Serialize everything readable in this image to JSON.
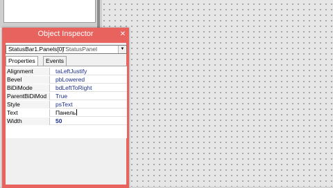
{
  "window": {
    "title": "Object Inspector",
    "close_glyph": "✕"
  },
  "component_selector": {
    "name": "StatusBar1.Panels[0]",
    "type": "TStatusPanel",
    "arrow_glyph": "▼"
  },
  "tabs": [
    {
      "label": "Properties",
      "active": true
    },
    {
      "label": "Events",
      "active": false
    }
  ],
  "properties": [
    {
      "name": "Alignment",
      "value": "taLeftJustify"
    },
    {
      "name": "Bevel",
      "value": "pbLowered"
    },
    {
      "name": "BiDiMode",
      "value": "bdLeftToRight"
    },
    {
      "name": "ParentBiDiMod",
      "value": "True"
    },
    {
      "name": "Style",
      "value": "psText"
    },
    {
      "name": "Text",
      "value": "Панель"
    },
    {
      "name": "Width",
      "value": "50"
    }
  ],
  "colors": {
    "window_frame": "#e8625e",
    "property_value": "#1c2f8a"
  }
}
